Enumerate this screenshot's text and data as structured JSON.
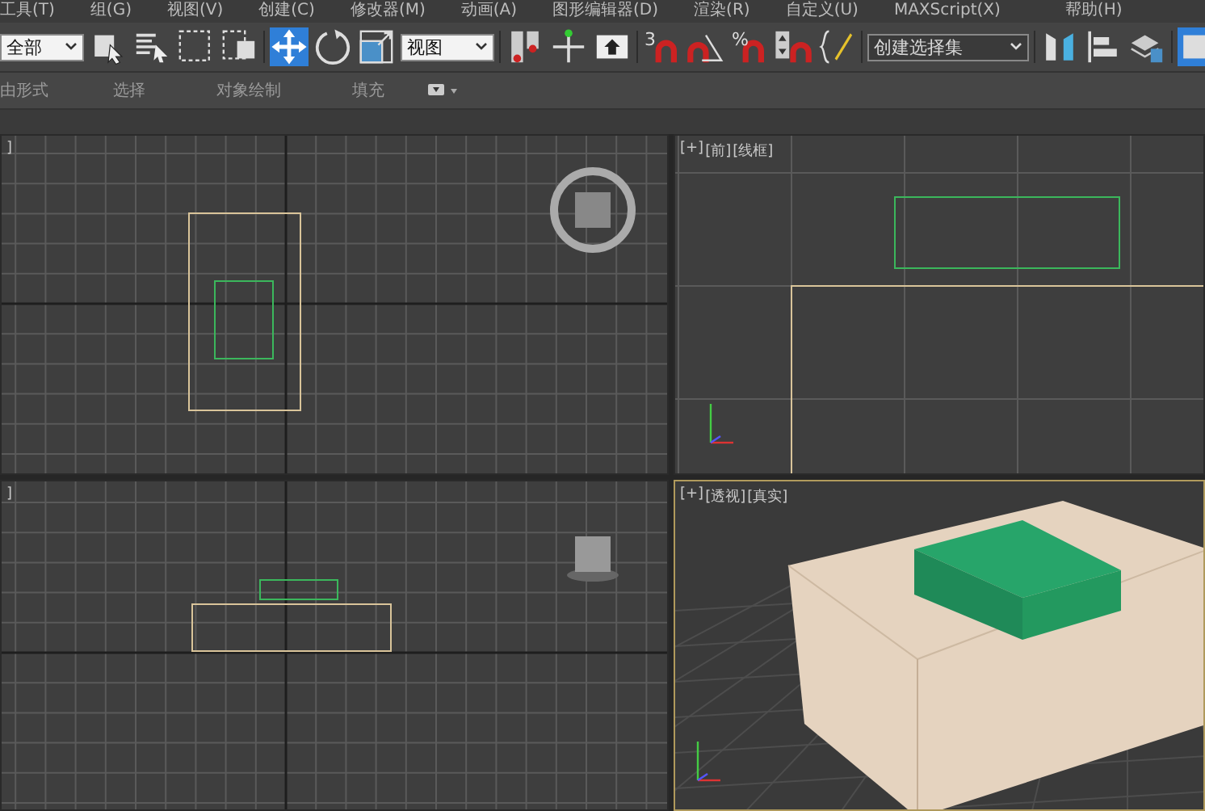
{
  "menu_bar": [
    {
      "label": "工具(T)"
    },
    {
      "label": "组(G)"
    },
    {
      "label": "视图(V)"
    },
    {
      "label": "创建(C)"
    },
    {
      "label": "修改器(M)"
    },
    {
      "label": "动画(A)"
    },
    {
      "label": "图形编辑器(D)"
    },
    {
      "label": "渲染(R)"
    },
    {
      "label": "自定义(U)"
    },
    {
      "label": "MAXScript(X)"
    },
    {
      "label": "帮助(H)"
    }
  ],
  "toolbar": [
    {
      "kind": "dropdown",
      "value": "全部"
    },
    {
      "kind": "button",
      "selected": false
    },
    {
      "kind": "button",
      "selected": false
    },
    {
      "kind": "button",
      "selected": false
    },
    {
      "kind": "button",
      "selected": false
    },
    {
      "kind": "button",
      "selected": true
    },
    {
      "kind": "button",
      "selected": false
    },
    {
      "kind": "button",
      "selected": false
    },
    {
      "kind": "dropdown",
      "value": "视图"
    },
    {
      "kind": "button",
      "selected": false
    },
    {
      "kind": "button",
      "selected": false
    },
    {
      "kind": "button",
      "selected": false
    },
    {
      "kind": "button",
      "selected": false,
      "label": "3"
    },
    {
      "kind": "button",
      "selected": false
    },
    {
      "kind": "button",
      "selected": false,
      "label": "%"
    },
    {
      "kind": "button",
      "selected": false
    },
    {
      "kind": "button",
      "selected": false
    },
    {
      "kind": "dropdown",
      "value": "创建选择集"
    },
    {
      "kind": "button",
      "selected": false
    },
    {
      "kind": "button",
      "selected": false
    },
    {
      "kind": "button",
      "selected": false
    },
    {
      "kind": "button",
      "selected": true
    }
  ],
  "ribbon_tabs": [
    {
      "label": "由形式"
    },
    {
      "label": "选择"
    },
    {
      "label": "对象绘制"
    },
    {
      "label": "填充"
    }
  ],
  "viewports": [
    {
      "labels": [
        "]"
      ],
      "selected": false
    },
    {
      "labels": [
        "[+]",
        "[前]",
        "[线框]"
      ],
      "selected": false
    },
    {
      "labels": [
        "]"
      ],
      "selected": false
    },
    {
      "labels": [
        "[+]",
        "[透视]",
        "[真实]"
      ],
      "selected": true
    }
  ]
}
